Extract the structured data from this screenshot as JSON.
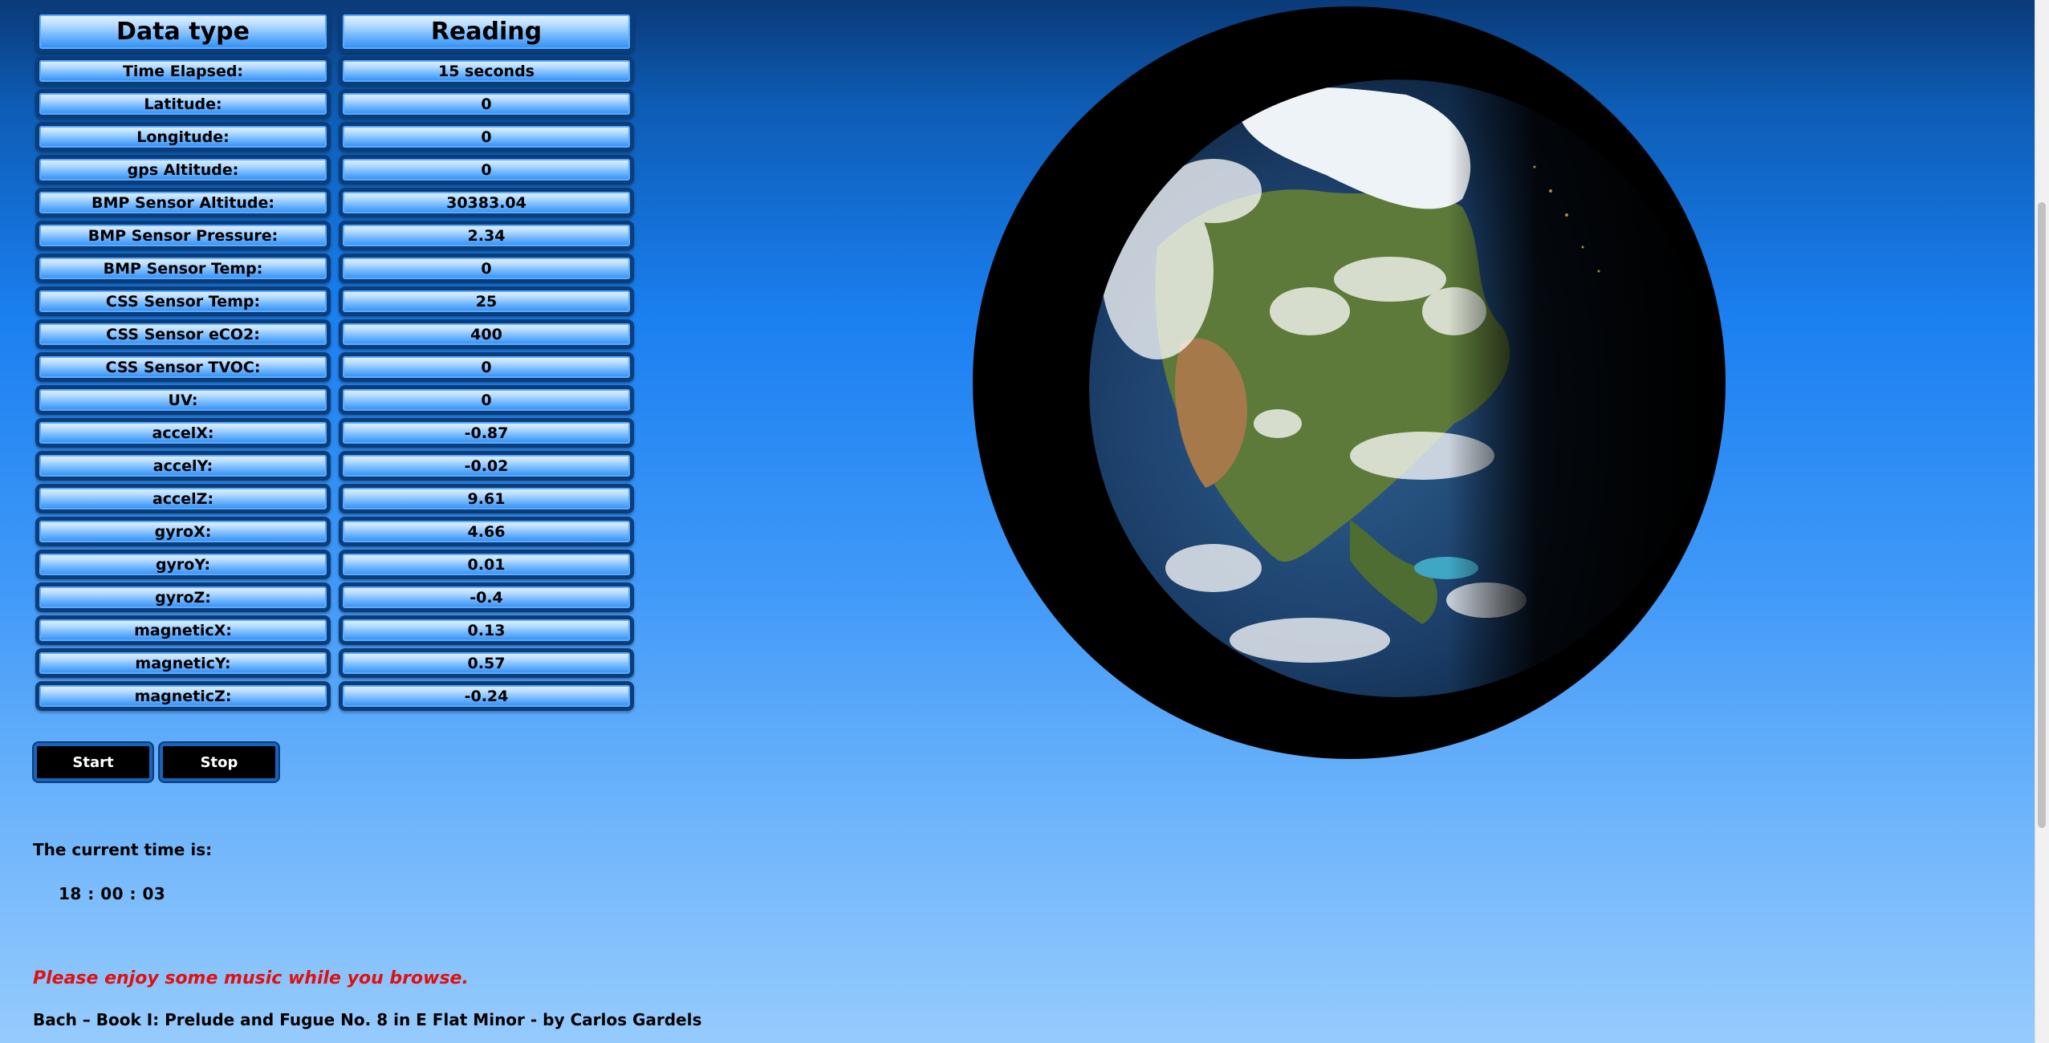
{
  "table": {
    "header": {
      "type_label": "Data type",
      "reading_label": "Reading"
    },
    "rows": [
      {
        "label": "Time Elapsed:",
        "value": "15 seconds"
      },
      {
        "label": "Latitude:",
        "value": "0"
      },
      {
        "label": "Longitude:",
        "value": "0"
      },
      {
        "label": "gps Altitude:",
        "value": "0"
      },
      {
        "label": "BMP Sensor Altitude:",
        "value": "30383.04"
      },
      {
        "label": "BMP Sensor Pressure:",
        "value": "2.34"
      },
      {
        "label": "BMP Sensor Temp:",
        "value": "0"
      },
      {
        "label": "CSS Sensor Temp:",
        "value": "25"
      },
      {
        "label": "CSS Sensor eCO2:",
        "value": "400"
      },
      {
        "label": "CSS Sensor TVOC:",
        "value": "0"
      },
      {
        "label": "UV:",
        "value": "0"
      },
      {
        "label": "accelX:",
        "value": "-0.87"
      },
      {
        "label": "accelY:",
        "value": "-0.02"
      },
      {
        "label": "accelZ:",
        "value": "9.61"
      },
      {
        "label": "gyroX:",
        "value": "4.66"
      },
      {
        "label": "gyroY:",
        "value": "0.01"
      },
      {
        "label": "gyroZ:",
        "value": "-0.4"
      },
      {
        "label": "magneticX:",
        "value": "0.13"
      },
      {
        "label": "magneticY:",
        "value": "0.57"
      },
      {
        "label": "magneticZ:",
        "value": "-0.24"
      }
    ]
  },
  "controls": {
    "start_label": "Start",
    "stop_label": "Stop"
  },
  "clock": {
    "label": "The current time is:",
    "value": "18 : 00 : 03"
  },
  "music": {
    "note": "Please enjoy some music while you browse.",
    "track": "Bach – Book I: Prelude and Fugue No. 8 in E Flat Minor - by Carlos Gardels"
  },
  "colors": {
    "page_accent": "#1a7ff0",
    "cell_border": "#0b3d7a",
    "music_note": "#e01010"
  },
  "icons": {
    "globe": "earth-globe-image"
  }
}
